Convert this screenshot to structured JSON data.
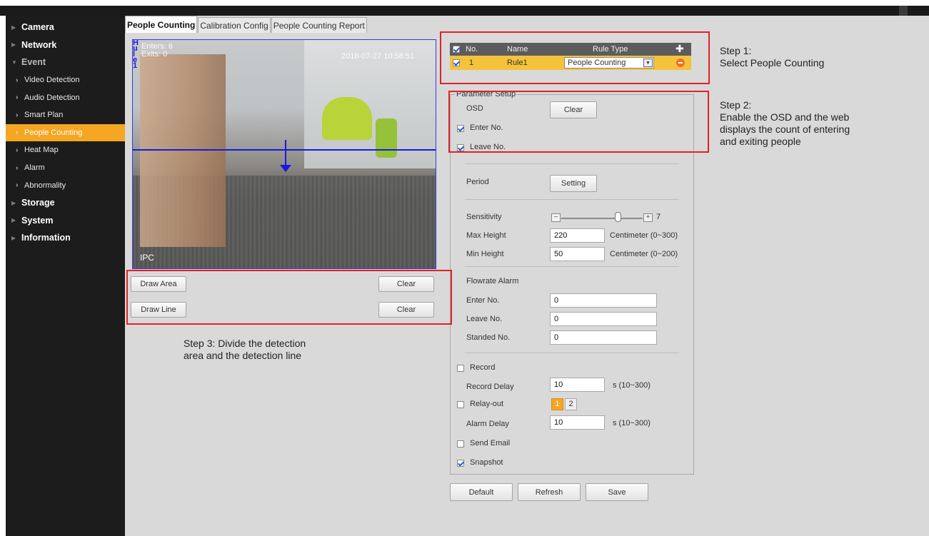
{
  "sidebar": {
    "items": [
      {
        "label": "Camera"
      },
      {
        "label": "Network"
      },
      {
        "label": "Event"
      },
      {
        "label": "Video Detection"
      },
      {
        "label": "Audio Detection"
      },
      {
        "label": "Smart Plan"
      },
      {
        "label": "People Counting"
      },
      {
        "label": "Heat Map"
      },
      {
        "label": "Alarm"
      },
      {
        "label": "Abnormality"
      },
      {
        "label": "Storage"
      },
      {
        "label": "System"
      },
      {
        "label": "Information"
      }
    ]
  },
  "tabs": [
    "People Counting",
    "Calibration Config",
    "People Counting Report"
  ],
  "video": {
    "osd_stripe": "Hu l e 1",
    "enters": "Enters: 6",
    "exits": "Exits: 0",
    "timestamp": "2018-07-27 10:58:51",
    "channel": "IPC"
  },
  "draw": {
    "draw_area": "Draw Area",
    "draw_line": "Draw Line",
    "clear": "Clear"
  },
  "rules": {
    "headers": {
      "no": "No.",
      "name": "Name",
      "rule_type": "Rule Type"
    },
    "row": {
      "no": "1",
      "name": "Rule1",
      "rule_type": "People Counting"
    }
  },
  "params": {
    "legend": "Parameter Setup",
    "osd": "OSD",
    "osd_clear": "Clear",
    "enter_no": "Enter No.",
    "leave_no": "Leave No.",
    "period": "Period",
    "setting": "Setting",
    "sensitivity": "Sensitivity",
    "sensitivity_value": "7",
    "sensitivity_level": 0.7,
    "max_height": "Max Height",
    "max_height_value": "220",
    "max_height_unit": "Centimeter (0~300)",
    "min_height": "Min Height",
    "min_height_value": "50",
    "min_height_unit": "Centimeter (0~200)",
    "flowrate_alarm": "Flowrate Alarm",
    "alarm_enter_no": "Enter No.",
    "alarm_enter_value": "0",
    "alarm_leave_no": "Leave No.",
    "alarm_leave_value": "0",
    "standed_no": "Standed No.",
    "standed_value": "0",
    "record": "Record",
    "record_delay": "Record Delay",
    "record_delay_value": "10",
    "record_delay_unit": "s (10~300)",
    "relay_out": "Relay-out",
    "relay_1": "1",
    "relay_2": "2",
    "alarm_delay": "Alarm Delay",
    "alarm_delay_value": "10",
    "alarm_delay_unit": "s (10~300)",
    "send_email": "Send Email",
    "snapshot": "Snapshot"
  },
  "footer": {
    "default": "Default",
    "refresh": "Refresh",
    "save": "Save"
  },
  "notes": {
    "step1": "Step 1:\nSelect People Counting",
    "step2": "Step 2:\nEnable the OSD and the web\ndisplays the count of entering\nand exiting people",
    "step3": "Step 3: Divide the detection\narea and the detection line"
  },
  "colors": {
    "accent": "#f5a623",
    "annotation_red": "#e0222a",
    "rule_row": "#f5c33b",
    "detection_blue": "#1a1adc"
  }
}
